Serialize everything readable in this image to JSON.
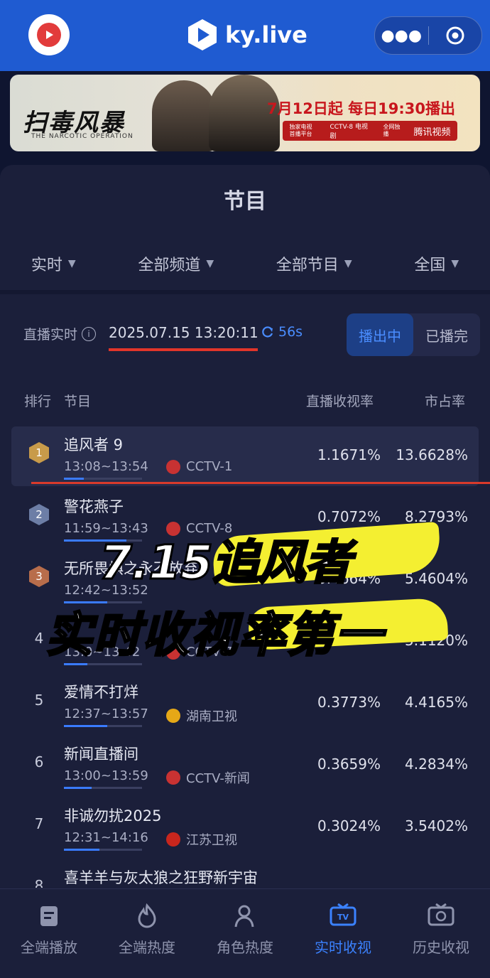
{
  "header": {
    "brand": "ky.live",
    "more_icon": "more-icon",
    "target_icon": "target-icon"
  },
  "banner": {
    "title": "扫毒风暴",
    "subtitle": "THE NARCOTIC OPERATION",
    "date": "7月12日起 每日19:30播出",
    "strip": [
      "独家电视首播平台",
      "CCTV-8 电视剧",
      "全网独播",
      "腾讯视频"
    ]
  },
  "panel": {
    "title": "节目"
  },
  "filters": [
    {
      "label": "实时"
    },
    {
      "label": "全部频道"
    },
    {
      "label": "全部节目"
    },
    {
      "label": "全国"
    }
  ],
  "live": {
    "label": "直播实时",
    "time": "2025.07.15 13:20:11",
    "refresh": "56s",
    "seg": [
      "播出中",
      "已播完"
    ]
  },
  "table": {
    "headers": [
      "排行",
      "节目",
      "直播收视率",
      "市占率"
    ],
    "rows": [
      {
        "rank": "1",
        "title": "追风者 9",
        "time": "13:08~13:54",
        "channel": "CCTV-1",
        "rating": "1.1671%",
        "share": "13.6628%",
        "progress": 0.25
      },
      {
        "rank": "2",
        "title": "警花燕子",
        "time": "11:59~13:43",
        "channel": "CCTV-8",
        "rating": "0.7072%",
        "share": "8.2793%",
        "progress": 0.8
      },
      {
        "rank": "3",
        "title": "无所畏惧之永不放弃",
        "time": "12:42~13:52",
        "channel": "",
        "rating": "0.4664%",
        "share": "5.4604%",
        "progress": 0.55
      },
      {
        "rank": "4",
        "title": "",
        "time": "13:0~13:42",
        "channel": "CCTV-7",
        "rating": "",
        "share": "5.1120%",
        "progress": 0.3
      },
      {
        "rank": "5",
        "title": "爱情不打烊",
        "time": "12:37~13:57",
        "channel": "湖南卫视",
        "rating": "0.3773%",
        "share": "4.4165%",
        "progress": 0.55
      },
      {
        "rank": "6",
        "title": "新闻直播间",
        "time": "13:00~13:59",
        "channel": "CCTV-新闻",
        "rating": "0.3659%",
        "share": "4.2834%",
        "progress": 0.35
      },
      {
        "rank": "7",
        "title": "非诚勿扰2025",
        "time": "12:31~14:16",
        "channel": "江苏卫视",
        "rating": "0.3024%",
        "share": "3.5402%",
        "progress": 0.45
      },
      {
        "rank": "8",
        "title": "喜羊羊与灰太狼之狂野新宇宙",
        "time": "",
        "channel": "",
        "rating": "",
        "share": "",
        "progress": 0
      }
    ]
  },
  "overlay": {
    "line1": "7.15追风者",
    "line2": "实时收视率第一"
  },
  "bottomnav": [
    {
      "label": "全端播放",
      "icon": "player-icon"
    },
    {
      "label": "全端热度",
      "icon": "fire-icon"
    },
    {
      "label": "角色热度",
      "icon": "person-icon"
    },
    {
      "label": "实时收视",
      "icon": "tv-icon",
      "active": true
    },
    {
      "label": "历史收视",
      "icon": "history-tv-icon"
    }
  ],
  "colors": {
    "accent": "#3b82ff",
    "topbar": "#1f5bd1",
    "highlight": "#f4ef31",
    "underline": "#d93a2b"
  }
}
